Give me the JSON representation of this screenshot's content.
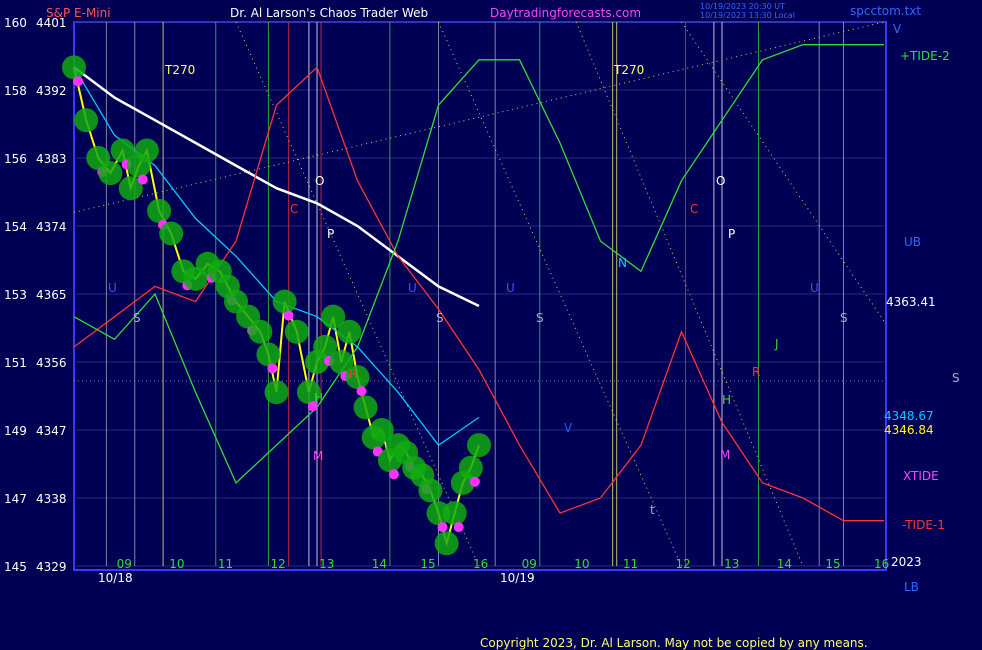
{
  "chart_data": {
    "type": "line",
    "title": "Dr. Al Larson's Chaos Trader Web",
    "instrument": "S&P E-Mini",
    "website": "Daytradingforecasts.com",
    "stamp_lines": [
      "10/19/2023 20:30 UT",
      "10/19/2023 13:30 Local"
    ],
    "file_name": "spcctom.txt",
    "copyright": "Copyright 2023, Dr. Al Larson. May not be copied by any means.",
    "y_left_ticks": [
      {
        "label": "160",
        "price": 4401
      },
      {
        "label": "158",
        "price": 4392
      },
      {
        "label": "156",
        "price": 4383
      },
      {
        "label": "154",
        "price": 4374
      },
      {
        "label": "153",
        "price": 4365
      },
      {
        "label": "151",
        "price": 4356
      },
      {
        "label": "149",
        "price": 4347
      },
      {
        "label": "147",
        "price": 4338
      },
      {
        "label": "145",
        "price": 4329
      }
    ],
    "y_range": [
      4329,
      4401
    ],
    "x_hour_labels": [
      "09",
      "10",
      "11",
      "12",
      "13",
      "14",
      "15",
      "16",
      "09",
      "10",
      "11",
      "12",
      "13",
      "14",
      "15",
      "16"
    ],
    "x_dates": [
      "10/18",
      "10/19"
    ],
    "year_label": "2023",
    "right_labels": {
      "v": "V",
      "tide2": "+TIDE-2",
      "ub": "UB",
      "price_a": "4363.41",
      "s_far": "S",
      "price_b": "4348.67",
      "price_c": "4346.84",
      "xtide": "XTIDE",
      "tide1": "-TIDE-1",
      "lb": "LB"
    },
    "marker_labels": {
      "t270_a": "T270",
      "t270_b": "T270",
      "o_a": "O",
      "o_b": "O",
      "p_a": "P",
      "p_b": "P",
      "c_a": "C",
      "c_b": "C",
      "n": "N",
      "j": "J",
      "r_a": "R",
      "r_b": "R",
      "h_a": "H",
      "h_b": "H",
      "m_a": "M",
      "m_b": "M",
      "u_a": "U",
      "u_b": "U",
      "u_c": "U",
      "u_d": "U",
      "s_1": "S",
      "s_2": "S",
      "s_3": "S",
      "s_4": "S",
      "v_mid": "V",
      "t_small": "t"
    },
    "series": [
      {
        "name": "price",
        "color": "#ffff00",
        "x": [
          0,
          0.03,
          0.06,
          0.09,
          0.12,
          0.14,
          0.16,
          0.18,
          0.21,
          0.24,
          0.27,
          0.3,
          0.33,
          0.36,
          0.38,
          0.4,
          0.43,
          0.46,
          0.48,
          0.5,
          0.52,
          0.55,
          0.58,
          0.6,
          0.62,
          0.64,
          0.66,
          0.68,
          0.7,
          0.72,
          0.74,
          0.76,
          0.78,
          0.8,
          0.82,
          0.84,
          0.86,
          0.88,
          0.9,
          0.92,
          0.94,
          0.96,
          0.98,
          1.0
        ],
        "y": [
          4395,
          4388,
          4383,
          4381,
          4384,
          4379,
          4382,
          4384,
          4376,
          4373,
          4368,
          4367,
          4369,
          4368,
          4366,
          4364,
          4362,
          4360,
          4357,
          4352,
          4364,
          4360,
          4352,
          4356,
          4358,
          4362,
          4356,
          4360,
          4354,
          4350,
          4346,
          4347,
          4343,
          4345,
          4344,
          4342,
          4341,
          4339,
          4336,
          4332,
          4336,
          4340,
          4342,
          4345
        ]
      },
      {
        "name": "ma-fast",
        "color": "#00ccff",
        "x": [
          0,
          0.1,
          0.2,
          0.3,
          0.4,
          0.5,
          0.6,
          0.7,
          0.8,
          0.9,
          1.0
        ],
        "y": [
          4395,
          4386,
          4382,
          4375,
          4370,
          4364,
          4362,
          4358,
          4352,
          4345,
          4348.67
        ]
      },
      {
        "name": "ma-slow",
        "color": "#ffffff",
        "x": [
          0,
          0.1,
          0.2,
          0.3,
          0.4,
          0.5,
          0.6,
          0.7,
          0.8,
          0.9,
          1.0
        ],
        "y": [
          4395,
          4391,
          4388,
          4385,
          4382,
          4379,
          4377,
          4374,
          4370,
          4366,
          4363.41
        ]
      },
      {
        "name": "tide-1",
        "color": "#ff3333",
        "x": [
          0.0,
          0.05,
          0.1,
          0.15,
          0.2,
          0.25,
          0.3,
          0.35,
          0.4,
          0.45,
          0.5,
          0.55,
          0.6,
          0.65,
          0.7,
          0.75,
          0.8,
          0.85,
          0.9,
          0.95,
          1.0
        ],
        "y": [
          4358,
          4362,
          4366,
          4364,
          4372,
          4390,
          4395,
          4380,
          4370,
          4363,
          4355,
          4345,
          4336,
          4338,
          4345,
          4360,
          4348,
          4340,
          4338,
          4335,
          4335
        ]
      },
      {
        "name": "tide-2",
        "color": "#33dd33",
        "x": [
          0.0,
          0.05,
          0.1,
          0.15,
          0.2,
          0.25,
          0.3,
          0.35,
          0.4,
          0.45,
          0.5,
          0.55,
          0.6,
          0.65,
          0.7,
          0.75,
          0.8,
          0.85,
          0.9,
          0.95,
          1.0
        ],
        "y": [
          4362,
          4359,
          4365,
          4352,
          4340,
          4345,
          4350,
          4358,
          4372,
          4390,
          4396,
          4396,
          4385,
          4372,
          4368,
          4380,
          4388,
          4396,
          4398,
          4398,
          4398
        ]
      }
    ]
  }
}
